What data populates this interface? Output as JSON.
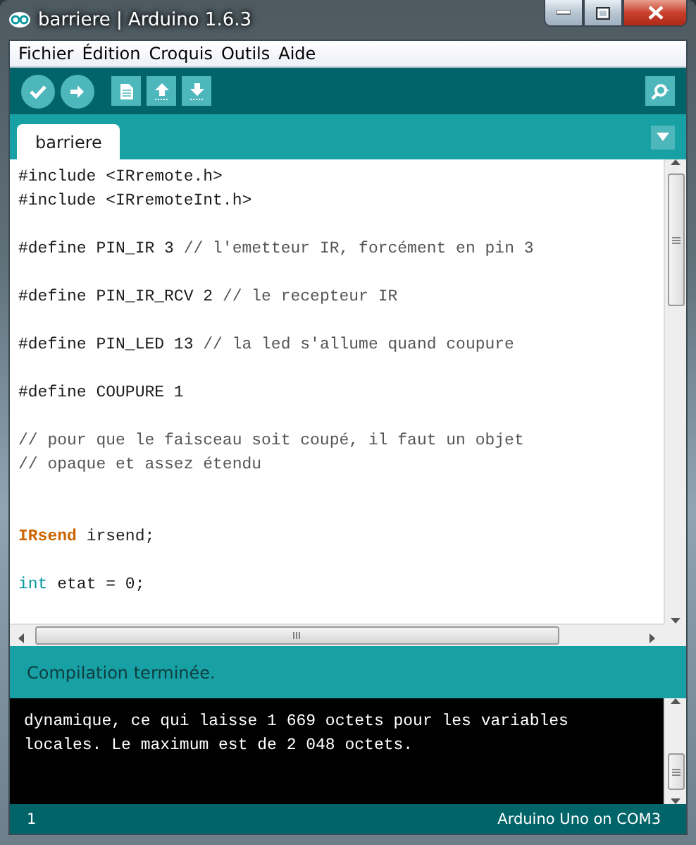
{
  "window": {
    "title": "barriere | Arduino 1.6.3"
  },
  "menu": [
    "Fichier",
    "Édition",
    "Croquis",
    "Outils",
    "Aide"
  ],
  "tabs": [
    {
      "label": "barriere",
      "selected": true
    }
  ],
  "code": [
    {
      "kind": "code",
      "segments": [
        {
          "kind": "plain",
          "text": "#include <IRremote.h>"
        }
      ]
    },
    {
      "kind": "code",
      "segments": [
        {
          "kind": "plain",
          "text": "#include <IRremoteInt.h>"
        }
      ]
    },
    {
      "kind": "blank"
    },
    {
      "kind": "code",
      "segments": [
        {
          "kind": "plain",
          "text": "#define PIN_IR 3 "
        },
        {
          "kind": "comment",
          "text": "// l'emetteur IR, forcément en pin 3"
        }
      ]
    },
    {
      "kind": "blank"
    },
    {
      "kind": "code",
      "segments": [
        {
          "kind": "plain",
          "text": "#define PIN_IR_RCV 2 "
        },
        {
          "kind": "comment",
          "text": "// le recepteur IR"
        }
      ]
    },
    {
      "kind": "blank"
    },
    {
      "kind": "code",
      "segments": [
        {
          "kind": "plain",
          "text": "#define PIN_LED 13 "
        },
        {
          "kind": "comment",
          "text": "// la led s'allume quand coupure"
        }
      ]
    },
    {
      "kind": "blank"
    },
    {
      "kind": "code",
      "segments": [
        {
          "kind": "plain",
          "text": "#define COUPURE 1"
        }
      ]
    },
    {
      "kind": "blank"
    },
    {
      "kind": "code",
      "segments": [
        {
          "kind": "comment",
          "text": "// pour que le faisceau soit coupé, il faut un objet"
        }
      ]
    },
    {
      "kind": "code",
      "segments": [
        {
          "kind": "comment",
          "text": "// opaque et assez étendu"
        }
      ]
    },
    {
      "kind": "blank"
    },
    {
      "kind": "blank"
    },
    {
      "kind": "code",
      "segments": [
        {
          "kind": "type",
          "text": "IRsend"
        },
        {
          "kind": "plain",
          "text": " irsend;"
        }
      ]
    },
    {
      "kind": "blank"
    },
    {
      "kind": "code",
      "segments": [
        {
          "kind": "keyword",
          "text": "int"
        },
        {
          "kind": "plain",
          "text": " etat = 0;"
        }
      ]
    }
  ],
  "message": "Compilation terminée.",
  "console": [
    "dynamique, ce qui laisse 1 669 octets pour les variables",
    "locales. Le maximum est de 2 048 octets."
  ],
  "status_bar": {
    "line": "1",
    "board": "Arduino Uno on COM3"
  }
}
